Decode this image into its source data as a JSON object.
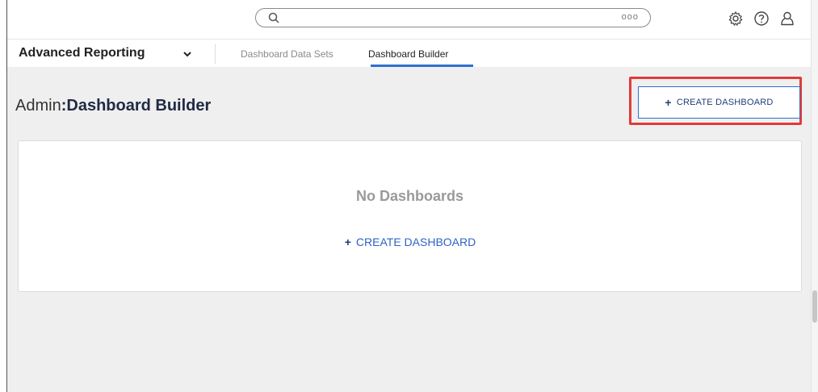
{
  "topbar": {
    "search": {
      "placeholder": "",
      "more_label": "ooo"
    },
    "icons": [
      "settings-gear-icon",
      "help-circle-icon",
      "user-profile-icon"
    ]
  },
  "navbar": {
    "module_name": "Advanced Reporting",
    "tabs": [
      {
        "label": "Dashboard Data Sets",
        "active": false
      },
      {
        "label": "Dashboard Builder",
        "active": true
      }
    ]
  },
  "page": {
    "title_prefix": "Admin",
    "title_colon": ":",
    "title_name": "Dashboard Builder"
  },
  "actions": {
    "create_dashboard_top": "CREATE DASHBOARD",
    "create_dashboard_center": "CREATE DASHBOARD",
    "plus_symbol": "+"
  },
  "empty_state": {
    "title": "No Dashboards"
  },
  "colors": {
    "accent": "#2f6fcf",
    "highlight": "#e23a3a",
    "title": "#1f2a44",
    "empty_text": "#9a9a9a"
  }
}
